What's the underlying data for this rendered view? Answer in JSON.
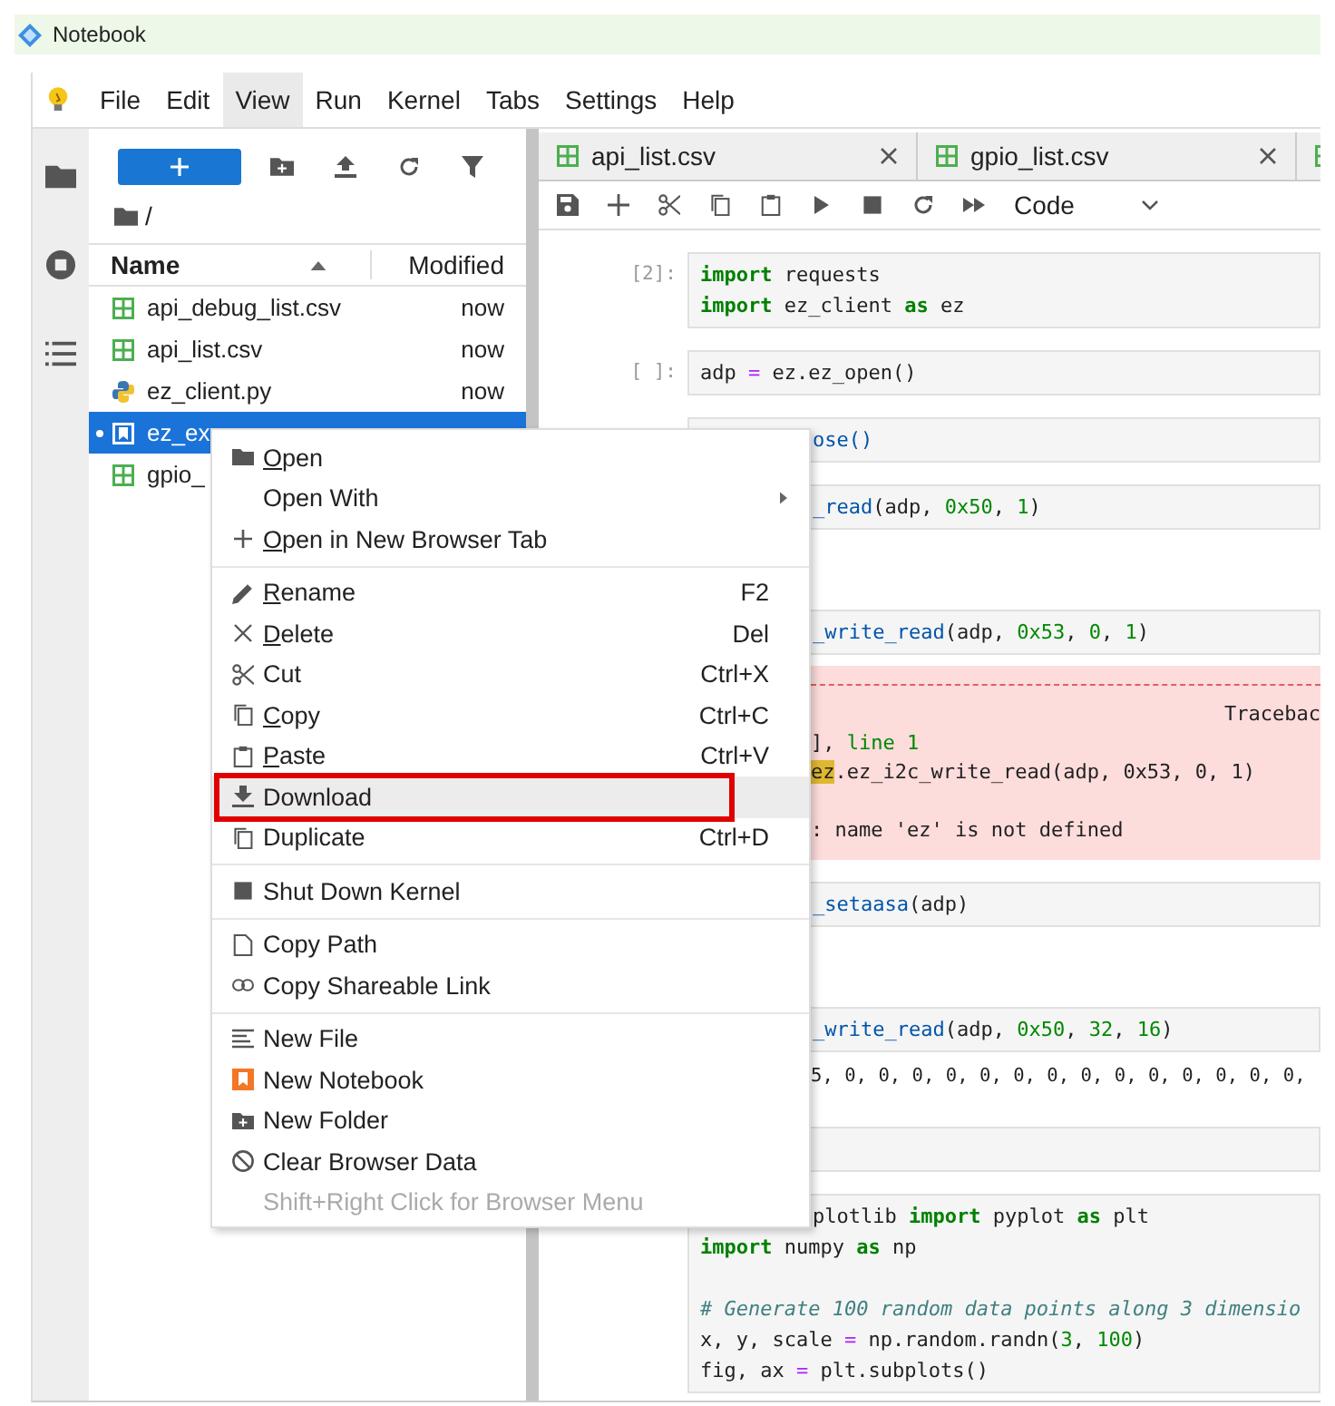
{
  "window": {
    "title": "Notebook"
  },
  "menubar": [
    {
      "label": "File",
      "selected": false
    },
    {
      "label": "Edit",
      "selected": false
    },
    {
      "label": "View",
      "selected": true
    },
    {
      "label": "Run",
      "selected": false
    },
    {
      "label": "Kernel",
      "selected": false
    },
    {
      "label": "Tabs",
      "selected": false
    },
    {
      "label": "Settings",
      "selected": false
    },
    {
      "label": "Help",
      "selected": false
    }
  ],
  "file_browser": {
    "path": "/",
    "columns": [
      "Name",
      "Modified"
    ],
    "files": [
      {
        "name": "api_debug_list.csv",
        "kind": "csv",
        "modified": "now",
        "selected": false,
        "running": false
      },
      {
        "name": "api_list.csv",
        "kind": "csv",
        "modified": "now",
        "selected": false,
        "running": false
      },
      {
        "name": "ez_client.py",
        "kind": "py",
        "modified": "now",
        "selected": false,
        "running": false
      },
      {
        "name": "ez_ex",
        "kind": "notebook",
        "selected": true,
        "running": true
      },
      {
        "name": "gpio_",
        "kind": "csv",
        "selected": false,
        "running": false
      }
    ]
  },
  "tabs": [
    {
      "label": "api_list.csv",
      "kind": "csv"
    },
    {
      "label": "gpio_list.csv",
      "kind": "csv"
    },
    {
      "kind": "csv"
    }
  ],
  "toolbar": {
    "cell_type": "Code"
  },
  "cells": [
    {
      "prompt": "[2]:",
      "covered": false,
      "lines": [
        {
          "tokens": [
            {
              "text": "import",
              "kind": "kw"
            },
            {
              "text": " requests",
              "kind": "name"
            }
          ]
        },
        {
          "tokens": [
            {
              "text": "import",
              "kind": "kw"
            },
            {
              "text": " ez_client ",
              "kind": "name"
            },
            {
              "text": "as",
              "kind": "kw"
            },
            {
              "text": " ez",
              "kind": "name"
            }
          ]
        }
      ]
    },
    {
      "prompt": "[ ]:",
      "covered": false,
      "lines": [
        {
          "tokens": [
            {
              "text": "adp ",
              "kind": "name"
            },
            {
              "text": "=",
              "kind": "op"
            },
            {
              "text": " ez.ez_open()",
              "kind": "name"
            }
          ]
        }
      ]
    },
    {
      "covered": true,
      "lines": [
        {
          "tokens": [
            {
              "text": "ose()",
              "kind": "fn"
            }
          ]
        }
      ]
    },
    {
      "covered": true,
      "lines": [
        {
          "tokens": [
            {
              "text": "_read",
              "kind": "fn"
            },
            {
              "text": "(adp, ",
              "kind": "name"
            },
            {
              "text": "0x50",
              "kind": "num"
            },
            {
              "text": ", ",
              "kind": "name"
            },
            {
              "text": "1",
              "kind": "num"
            },
            {
              "text": ")",
              "kind": "name"
            }
          ]
        }
      ],
      "output": {
        "kind": "empty"
      }
    },
    {
      "covered": true,
      "lines": [
        {
          "tokens": [
            {
              "text": "_write_read",
              "kind": "fn"
            },
            {
              "text": "(adp, ",
              "kind": "name"
            },
            {
              "text": "0x53",
              "kind": "num"
            },
            {
              "text": ", ",
              "kind": "name"
            },
            {
              "text": "0",
              "kind": "num"
            },
            {
              "text": ", ",
              "kind": "name"
            },
            {
              "text": "1",
              "kind": "num"
            },
            {
              "text": ")",
              "kind": "name"
            }
          ]
        }
      ],
      "output": {
        "kind": "error",
        "lines": [
          {
            "cut_right": true,
            "spaced": false,
            "tokens": [
              {
                "text": "Tracebac",
                "kind": "name"
              }
            ]
          },
          {
            "cut_right": false,
            "spaced": false,
            "tokens": [
              {
                "text": "], ",
                "kind": "name"
              },
              {
                "text": "line 1",
                "kind": "num"
              }
            ]
          },
          {
            "cut_right": false,
            "spaced": false,
            "tokens": [
              {
                "text": "ez",
                "kind": "hl"
              },
              {
                "text": ".ez_i2c_write_read(adp, 0x53, 0, 1)",
                "kind": "name"
              }
            ]
          },
          {
            "cut_right": false,
            "spaced": true,
            "tokens": [
              {
                "text": ": name 'ez' is not defined",
                "kind": "name"
              }
            ]
          }
        ]
      }
    },
    {
      "covered": true,
      "lines": [
        {
          "tokens": [
            {
              "text": "_setaasa",
              "kind": "fn"
            },
            {
              "text": "(adp)",
              "kind": "name"
            }
          ]
        }
      ],
      "output": {
        "kind": "empty"
      }
    },
    {
      "covered": true,
      "lines": [
        {
          "tokens": [
            {
              "text": "_write_read",
              "kind": "fn"
            },
            {
              "text": "(adp, ",
              "kind": "name"
            },
            {
              "text": "0x50",
              "kind": "num"
            },
            {
              "text": ", ",
              "kind": "name"
            },
            {
              "text": "32",
              "kind": "num"
            },
            {
              "text": ", ",
              "kind": "name"
            },
            {
              "text": "16",
              "kind": "num"
            },
            {
              "text": ")",
              "kind": "name"
            }
          ]
        }
      ],
      "output": {
        "kind": "text",
        "lines": [
          "5, 0, 0, 0, 0, 0, 0, 0, 0, 0, 0, 0, 0, 0, 0,"
        ]
      }
    },
    {
      "kind": "code"
    },
    {
      "covered": true,
      "lines": [
        {
          "spaced": false,
          "tokens": [
            {
              "text": "plotlib ",
              "kind": "name"
            },
            {
              "text": "import",
              "kind": "kw"
            },
            {
              "text": " pyplot ",
              "kind": "name"
            },
            {
              "text": "as",
              "kind": "kw"
            },
            {
              "text": " plt",
              "kind": "name"
            }
          ]
        },
        {
          "spaced": false,
          "flush": true,
          "tokens": [
            {
              "text": "import",
              "kind": "kw"
            },
            {
              "text": " numpy ",
              "kind": "name"
            },
            {
              "text": "as",
              "kind": "kw"
            },
            {
              "text": " np",
              "kind": "name"
            }
          ]
        },
        {
          "spaced": true,
          "flush": true,
          "tokens": [
            {
              "text": "# Generate 100 random data points along 3 dimensio",
              "kind": "comment"
            }
          ]
        },
        {
          "spaced": false,
          "flush": true,
          "tokens": [
            {
              "text": "x, y, scale ",
              "kind": "name"
            },
            {
              "text": "=",
              "kind": "op"
            },
            {
              "text": " np.random.randn(",
              "kind": "name"
            },
            {
              "text": "3",
              "kind": "num"
            },
            {
              "text": ", ",
              "kind": "name"
            },
            {
              "text": "100",
              "kind": "num"
            },
            {
              "text": ")",
              "kind": "name"
            }
          ]
        },
        {
          "spaced": false,
          "flush": true,
          "tokens": [
            {
              "text": "fig, ax ",
              "kind": "name"
            },
            {
              "text": "=",
              "kind": "op"
            },
            {
              "text": " plt.subplots()",
              "kind": "name"
            }
          ]
        }
      ]
    }
  ],
  "context_menu": {
    "groups": [
      [
        {
          "label": "Open",
          "kind": "folder",
          "underline_first": true,
          "hovered": false,
          "disabled": false
        },
        {
          "label": "Open With",
          "kind": "none",
          "submenu": true,
          "underline_first": false,
          "hovered": false,
          "disabled": false
        },
        {
          "label": "Open in New Browser Tab",
          "kind": "plus",
          "underline_first": true,
          "hovered": false,
          "disabled": false
        }
      ],
      [
        {
          "label": "Rename",
          "kind": "pencil",
          "shortcut": "F2",
          "underline_first": true,
          "hovered": false,
          "disabled": false
        },
        {
          "label": "Delete",
          "kind": "x",
          "shortcut": "Del",
          "underline_first": true,
          "hovered": false,
          "disabled": false
        },
        {
          "label": "Cut",
          "kind": "scissors",
          "shortcut": "Ctrl+X",
          "underline_first": false,
          "hovered": false,
          "disabled": false
        },
        {
          "label": "Copy",
          "kind": "copy",
          "shortcut": "Ctrl+C",
          "underline_first": true,
          "hovered": false,
          "disabled": false
        },
        {
          "label": "Paste",
          "kind": "paste",
          "shortcut": "Ctrl+V",
          "underline_first": true,
          "hovered": false,
          "disabled": false
        },
        {
          "label": "Download",
          "kind": "download",
          "underline_first": false,
          "hovered": true,
          "annotated": true,
          "disabled": false
        },
        {
          "label": "Duplicate",
          "kind": "copy",
          "shortcut": "Ctrl+D",
          "underline_first": false,
          "hovered": false,
          "disabled": false
        }
      ],
      [
        {
          "label": "Shut Down Kernel",
          "kind": "square",
          "underline_first": false,
          "hovered": false,
          "disabled": false
        }
      ],
      [
        {
          "label": "Copy Path",
          "kind": "file",
          "underline_first": false,
          "hovered": false,
          "disabled": false
        },
        {
          "label": "Copy Shareable Link",
          "kind": "link",
          "underline_first": false,
          "hovered": false,
          "disabled": false
        }
      ],
      [
        {
          "label": "New File",
          "kind": "lines",
          "underline_first": false,
          "hovered": false,
          "disabled": false
        },
        {
          "label": "New Notebook",
          "kind": "notebook",
          "underline_first": false,
          "hovered": false,
          "disabled": false
        },
        {
          "label": "New Folder",
          "kind": "folder-plus",
          "underline_first": false,
          "hovered": false,
          "disabled": false
        },
        {
          "label": "Clear Browser Data",
          "kind": "ban",
          "underline_first": false,
          "hovered": false,
          "disabled": false
        },
        {
          "label": "Shift+Right Click for Browser Menu",
          "kind": "none",
          "underline_first": false,
          "hovered": false,
          "disabled": true
        }
      ]
    ]
  }
}
